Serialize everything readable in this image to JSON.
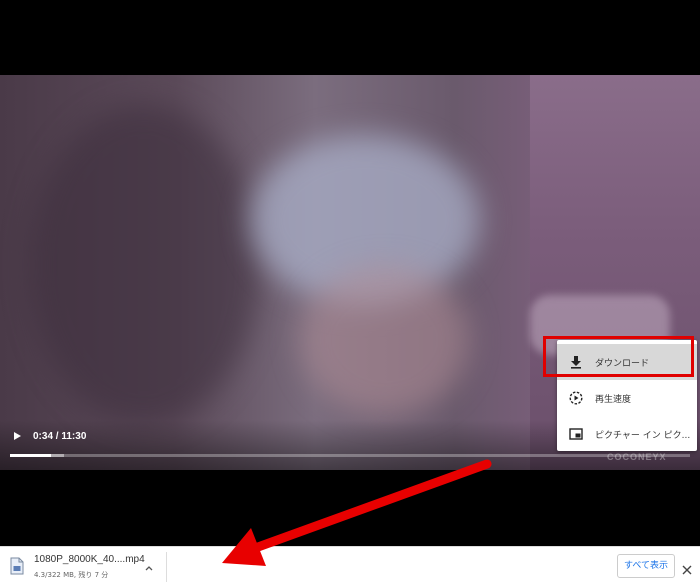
{
  "player": {
    "time": "0:34 / 11:30",
    "played_fraction": 0.06,
    "buffered_fraction": 0.08,
    "watermark": "COCONEYX",
    "menu": {
      "items": [
        {
          "label": "ダウンロード",
          "icon": "download-icon"
        },
        {
          "label": "再生速度",
          "icon": "playback-speed-icon"
        },
        {
          "label": "ピクチャー イン ピク...",
          "icon": "picture-in-picture-icon"
        }
      ]
    }
  },
  "downloads": {
    "file_name": "1080P_8000K_40....mp4",
    "status": "4.3/322 MB, 残り 7 分",
    "show_all_label": "すべて表示"
  },
  "colors": {
    "highlight": "#e00000",
    "arrow": "#e80000",
    "link": "#1a73e8"
  }
}
